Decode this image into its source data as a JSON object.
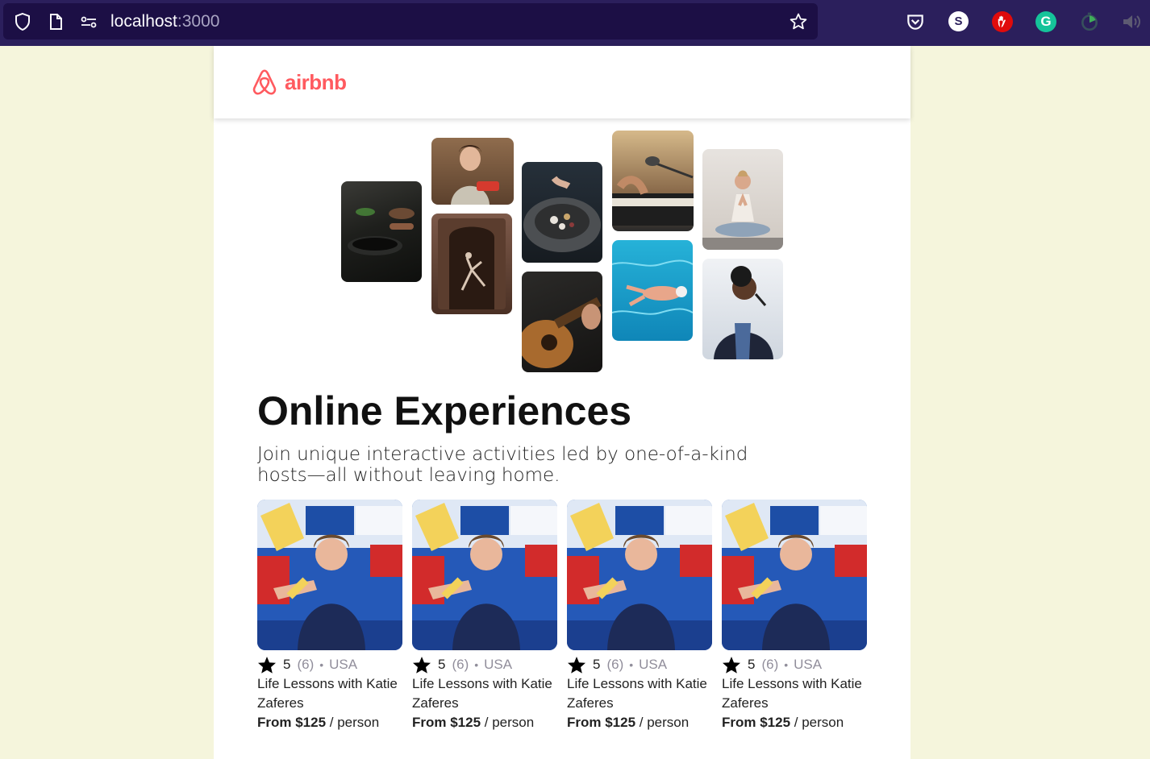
{
  "browser": {
    "url_host": "localhost",
    "url_port": ":3000",
    "icons": [
      "shield-icon",
      "page-icon",
      "permissions-icon",
      "bookmark-star-icon"
    ],
    "extensions": [
      "pocket-icon",
      "s-extension-icon",
      "adblock-icon",
      "grammarly-icon",
      "timer-icon",
      "speaker-icon"
    ],
    "ext_s_label": "S",
    "ext_g_label": "G"
  },
  "nav": {
    "logo_text": "airbnb"
  },
  "hero": {
    "title": "Online Experiences",
    "subtitle": "Join unique interactive activities led by one-of-a-kind hosts—all without leaving home."
  },
  "cards": [
    {
      "rating": "5",
      "count": "(6)",
      "sep": "•",
      "location": "USA",
      "title": "Life Lessons with Katie Zaferes",
      "price_prefix": "From $125",
      "price_suffix": " / person"
    },
    {
      "rating": "5",
      "count": "(6)",
      "sep": "•",
      "location": "USA",
      "title": "Life Lessons with Katie Zaferes",
      "price_prefix": "From $125",
      "price_suffix": " / person"
    },
    {
      "rating": "5",
      "count": "(6)",
      "sep": "•",
      "location": "USA",
      "title": "Life Lessons with Katie Zaferes",
      "price_prefix": "From $125",
      "price_suffix": " / person"
    },
    {
      "rating": "5",
      "count": "(6)",
      "sep": "•",
      "location": "USA",
      "title": "Life Lessons with Katie Zaferes",
      "price_prefix": "From $125",
      "price_suffix": " / person"
    }
  ],
  "colors": {
    "brand": "#ff5a5f",
    "browser_bg": "#2b1f5c",
    "page_bg": "#f5f5dc",
    "muted": "#918e9b"
  }
}
